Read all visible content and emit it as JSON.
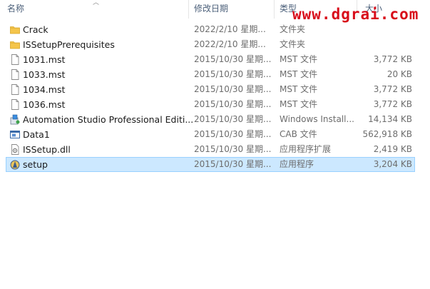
{
  "header": {
    "name": "名称",
    "date": "修改日期",
    "type": "类型",
    "size": "大小"
  },
  "watermark": "www.dgrai.com",
  "rows": [
    {
      "name": "Crack",
      "date": "2022/2/10 星期...",
      "type": "文件夹",
      "size": "",
      "icon": "folder-icon"
    },
    {
      "name": "ISSetupPrerequisites",
      "date": "2022/2/10 星期...",
      "type": "文件夹",
      "size": "",
      "icon": "folder-icon"
    },
    {
      "name": "1031.mst",
      "date": "2015/10/30 星期...",
      "type": "MST 文件",
      "size": "3,772 KB",
      "icon": "file-icon"
    },
    {
      "name": "1033.mst",
      "date": "2015/10/30 星期...",
      "type": "MST 文件",
      "size": "20 KB",
      "icon": "file-icon"
    },
    {
      "name": "1034.mst",
      "date": "2015/10/30 星期...",
      "type": "MST 文件",
      "size": "3,772 KB",
      "icon": "file-icon"
    },
    {
      "name": "1036.mst",
      "date": "2015/10/30 星期...",
      "type": "MST 文件",
      "size": "3,772 KB",
      "icon": "file-icon"
    },
    {
      "name": "Automation Studio Professional Editi...",
      "date": "2015/10/30 星期...",
      "type": "Windows Install...",
      "size": "14,134 KB",
      "icon": "installer-icon"
    },
    {
      "name": "Data1",
      "date": "2015/10/30 星期...",
      "type": "CAB 文件",
      "size": "562,918 KB",
      "icon": "cab-icon"
    },
    {
      "name": "ISSetup.dll",
      "date": "2015/10/30 星期...",
      "type": "应用程序扩展",
      "size": "2,419 KB",
      "icon": "dll-icon"
    },
    {
      "name": "setup",
      "date": "2015/10/30 星期...",
      "type": "应用程序",
      "size": "3,204 KB",
      "icon": "setup-icon",
      "selected": true
    }
  ]
}
